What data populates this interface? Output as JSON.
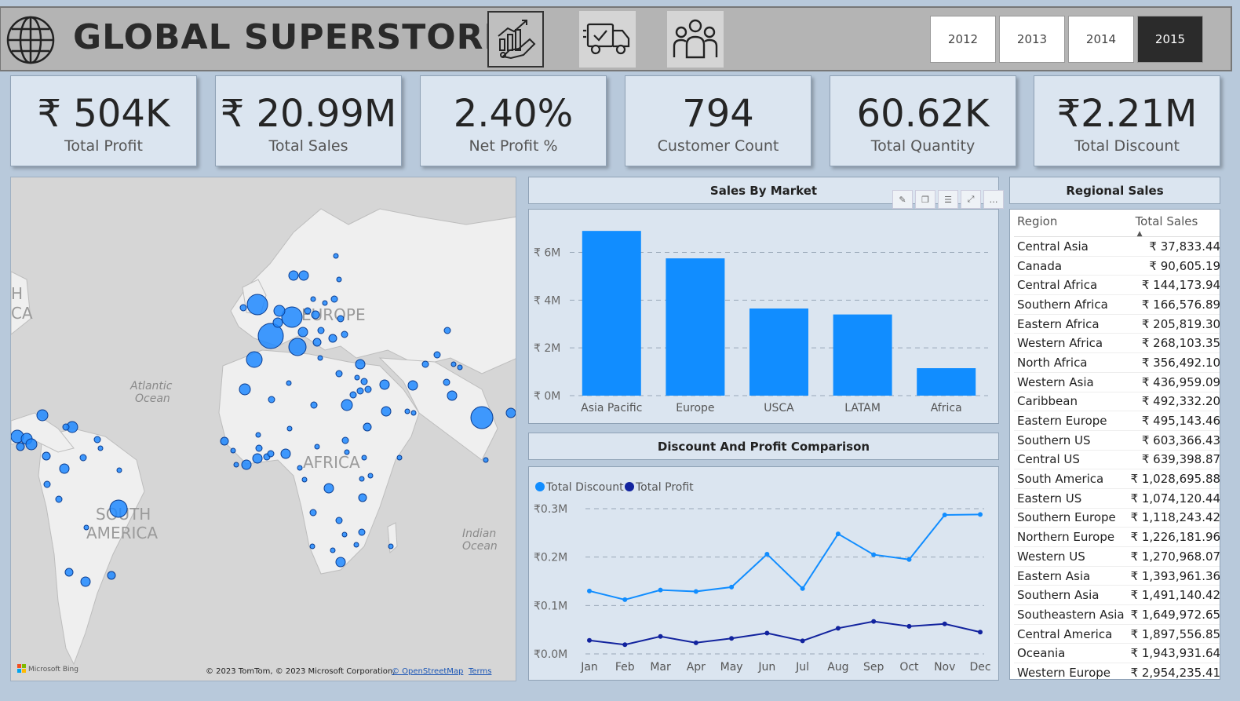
{
  "header": {
    "title": "GLOBAL SUPERSTORE",
    "icons": [
      "globe-icon",
      "growth-chart-icon",
      "delivery-truck-icon",
      "people-group-icon"
    ],
    "years": [
      "2012",
      "2013",
      "2014",
      "2015"
    ],
    "selected_year": "2015"
  },
  "kpis": [
    {
      "value": "₹ 504K",
      "label": "Total Profit"
    },
    {
      "value": "₹ 20.99M",
      "label": "Total Sales"
    },
    {
      "value": "2.40%",
      "label": "Net Profit %"
    },
    {
      "value": "794",
      "label": "Customer Count"
    },
    {
      "value": "60.62K",
      "label": "Total Quantity"
    },
    {
      "value": "₹2.21M",
      "label": "Total Discount"
    }
  ],
  "map": {
    "labels": {
      "europe": "EUROPE",
      "africa": "AFRICA",
      "south_america_1": "SOUTH",
      "south_america_2": "AMERICA",
      "atlantic_1": "Atlantic",
      "atlantic_2": "Ocean",
      "indian_1": "Indian",
      "indian_2": "Ocean",
      "edge_1": "H",
      "edge_2": "CA"
    },
    "logo": "Microsoft Bing",
    "attribution": "© 2023 TomTom, © 2023 Microsoft Corporation,",
    "osm_link": "© OpenStreetMap",
    "terms_link": "Terms"
  },
  "sales_by_market": {
    "title": "Sales By Market",
    "toolbar_icons": [
      "pin-icon",
      "copy-icon",
      "filter-icon",
      "focus-mode-icon",
      "more-options-icon"
    ],
    "chart_data": {
      "type": "bar",
      "categories": [
        "Asia Pacific",
        "Europe",
        "USCA",
        "LATAM",
        "Africa"
      ],
      "values": [
        6.9,
        5.75,
        3.65,
        3.4,
        1.15
      ],
      "unit": "M",
      "yticks": [
        "₹ 0M",
        "₹ 2M",
        "₹ 4M",
        "₹ 6M"
      ],
      "ylim": [
        0,
        7.3
      ],
      "grid": true,
      "color": "#118dff"
    }
  },
  "discount_profit": {
    "title": "Discount And Profit Comparison",
    "chart_data": {
      "type": "line",
      "x": [
        "Jan",
        "Feb",
        "Mar",
        "Apr",
        "May",
        "Jun",
        "Jul",
        "Aug",
        "Sep",
        "Oct",
        "Nov",
        "Dec"
      ],
      "series": [
        {
          "name": "Total Discount",
          "color": "#118dff",
          "values": [
            0.13,
            0.112,
            0.132,
            0.129,
            0.138,
            0.206,
            0.135,
            0.248,
            0.205,
            0.195,
            0.287,
            0.288
          ]
        },
        {
          "name": "Total Profit",
          "color": "#12239e",
          "values": [
            0.028,
            0.019,
            0.036,
            0.023,
            0.032,
            0.043,
            0.027,
            0.053,
            0.067,
            0.057,
            0.062,
            0.045
          ]
        }
      ],
      "yticks": [
        "₹0.0M",
        "₹0.1M",
        "₹0.2M",
        "₹0.3M"
      ],
      "ylim": [
        0,
        0.3
      ],
      "grid": true,
      "legend": "top-left"
    }
  },
  "regional_sales": {
    "title": "Regional Sales",
    "columns": [
      "Region",
      "Total Sales"
    ],
    "rows": [
      [
        "Central Asia",
        "₹ 37,833.44"
      ],
      [
        "Canada",
        "₹ 90,605.19"
      ],
      [
        "Central Africa",
        "₹ 144,173.94"
      ],
      [
        "Southern Africa",
        "₹ 166,576.89"
      ],
      [
        "Eastern Africa",
        "₹ 205,819.30"
      ],
      [
        "Western Africa",
        "₹ 268,103.35"
      ],
      [
        "North Africa",
        "₹ 356,492.10"
      ],
      [
        "Western Asia",
        "₹ 436,959.09"
      ],
      [
        "Caribbean",
        "₹ 492,332.20"
      ],
      [
        "Eastern Europe",
        "₹ 495,143.46"
      ],
      [
        "Southern US",
        "₹ 603,366.43"
      ],
      [
        "Central US",
        "₹ 639,398.87"
      ],
      [
        "South America",
        "₹ 1,028,695.88"
      ],
      [
        "Eastern US",
        "₹ 1,074,120.44"
      ],
      [
        "Southern Europe",
        "₹ 1,118,243.42"
      ],
      [
        "Northern Europe",
        "₹ 1,226,181.96"
      ],
      [
        "Western US",
        "₹ 1,270,968.07"
      ],
      [
        "Eastern Asia",
        "₹ 1,393,961.36"
      ],
      [
        "Southern Asia",
        "₹ 1,491,140.42"
      ],
      [
        "Southeastern Asia",
        "₹ 1,649,972.65"
      ],
      [
        "Central America",
        "₹ 1,897,556.85"
      ],
      [
        "Oceania",
        "₹ 1,943,931.64"
      ],
      [
        "Western Europe",
        "₹ 2,954,235.41"
      ]
    ]
  }
}
